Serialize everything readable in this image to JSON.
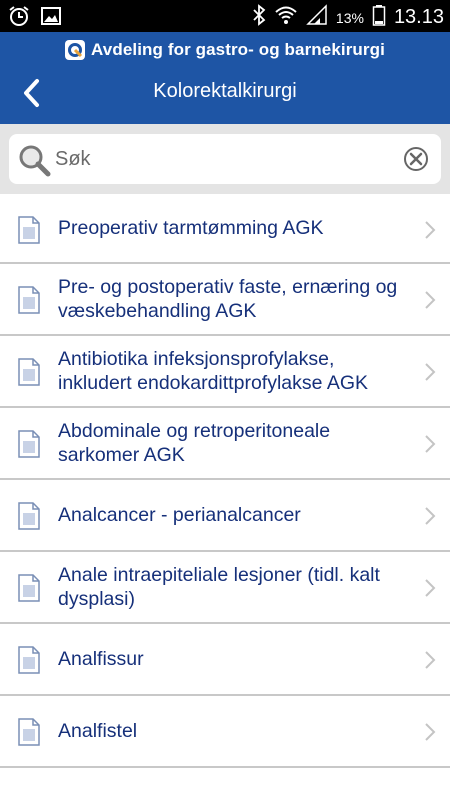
{
  "status_bar": {
    "battery_pct": "13%",
    "time": "13.13",
    "icons": [
      "alarm-icon",
      "image-icon",
      "bluetooth-icon",
      "wifi-icon",
      "signal-icon",
      "battery-icon"
    ]
  },
  "header": {
    "org_title": "Avdeling for gastro- og barnekirurgi",
    "page_title": "Kolorektalkirurgi",
    "background_color": "#1e55a5"
  },
  "search": {
    "placeholder": "Søk",
    "value": ""
  },
  "list": {
    "items": [
      {
        "label": "Preoperativ tarmtømming AGK"
      },
      {
        "label": "Pre- og postoperativ faste, ernæring og væskebehandling AGK"
      },
      {
        "label": "Antibiotika infeksjonsprofylakse, inkludert endokardittprofylakse AGK"
      },
      {
        "label": "Abdominale og retroperitoneale sarkomer AGK"
      },
      {
        "label": "Analcancer - perianalcancer"
      },
      {
        "label": "Anale intraepiteliale lesjoner (tidl. kalt dysplasi)"
      },
      {
        "label": "Analfissur"
      },
      {
        "label": "Analfistel"
      }
    ],
    "text_color": "#16307a"
  }
}
